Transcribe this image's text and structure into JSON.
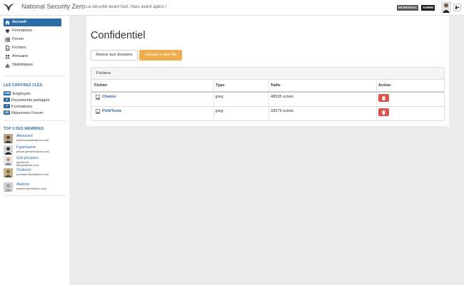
{
  "header": {
    "brand": "National Security Zero",
    "tagline": "La sécurité avant tout, mais avant apéro !",
    "user_name": "MCRESSAC",
    "user_role": "ADMIN"
  },
  "sidebar": {
    "nav": [
      {
        "label": "Accueil",
        "icon": "home-icon",
        "active": true
      },
      {
        "label": "Formations",
        "icon": "graduation-cap-icon"
      },
      {
        "label": "Forum",
        "icon": "list-icon"
      },
      {
        "label": "Fichiers",
        "icon": "file-icon"
      },
      {
        "label": "Annuaire",
        "icon": "users-icon"
      },
      {
        "label": "Statistiques",
        "icon": "bar-chart-icon"
      }
    ],
    "stats_title": "LES CHIFFRES CLÉS",
    "stats": [
      {
        "count": "136",
        "label": "Employés"
      },
      {
        "count": "3",
        "label": "Documents partagés"
      },
      {
        "count": "7",
        "label": "Formations"
      },
      {
        "count": "20",
        "label": "Réponses Forum"
      }
    ],
    "members_title": "TOP 5 DES MEMBRES",
    "members": [
      {
        "name": "Alessard",
        "email": "(arienne.lessard@nsz.com)"
      },
      {
        "name": "Fgamache",
        "email": "(franck.gamache@nsz.com)"
      },
      {
        "name": "Gst-jacques",
        "email_line1": "(gerland st-",
        "email_line2": "jacques@nsz.com)"
      },
      {
        "name": "Clafond",
        "email": "(cressant.lafond@nsz.com)"
      },
      {
        "name": "Alabrie",
        "email": "(arienne.labrie@nsz.com)"
      }
    ]
  },
  "main": {
    "title": "Confidentiel",
    "back_button": "Retour aux dossiers",
    "upload_button": "Upload a new file",
    "panel_heading": "Fichiers",
    "columns": [
      "Fichier",
      "Type",
      "Taille",
      "Action"
    ],
    "files": [
      {
        "name": "Chaton",
        "type": "jpeg",
        "size": "48535 octets"
      },
      {
        "name": "PetitTeste",
        "type": "jpeg",
        "size": "33579 octets"
      }
    ]
  },
  "colors": {
    "primary": "#2d6ba8",
    "warning": "#f0ad4e",
    "danger": "#d9534f"
  }
}
